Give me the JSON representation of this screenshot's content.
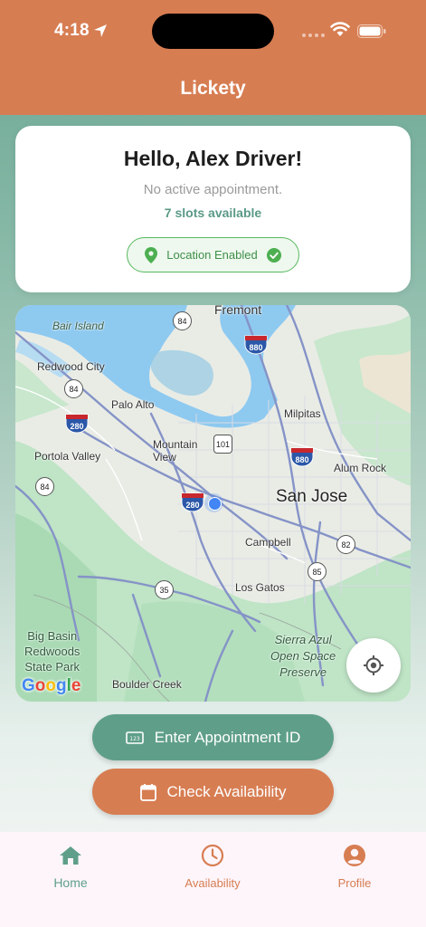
{
  "status_bar": {
    "time": "4:18"
  },
  "header": {
    "title": "Lickety"
  },
  "greeting": {
    "title": "Hello, Alex Driver!",
    "appointment_status": "No active appointment.",
    "slots_available": "7 slots available",
    "location_badge": "Location Enabled"
  },
  "map": {
    "labels": {
      "fremont": "Fremont",
      "bair_island": "Bair Island",
      "redwood_city": "Redwood City",
      "palo_alto": "Palo Alto",
      "milpitas": "Milpitas",
      "mountain_view": "Mountain\nView",
      "portola_valley": "Portola Valley",
      "alum_rock": "Alum Rock",
      "san_jose": "San Jose",
      "campbell": "Campbell",
      "los_gatos": "Los Gatos",
      "big_basin": "Big Basin\nRedwoods\nState Park",
      "sierra_azul": "Sierra Azul\nOpen Space\nPreserve",
      "boulder_creek": "Boulder Creek"
    },
    "shields": {
      "r84a": "84",
      "r84b": "84",
      "r84c": "84",
      "r880a": "880",
      "r880b": "880",
      "r280a": "280",
      "r280b": "280",
      "r101": "101",
      "r82": "82",
      "r85": "85",
      "r35": "35"
    },
    "attribution": "Google"
  },
  "actions": {
    "enter_appointment": "Enter Appointment ID",
    "check_availability": "Check Availability"
  },
  "nav": {
    "home": "Home",
    "availability": "Availability",
    "profile": "Profile"
  },
  "colors": {
    "primary_orange": "#d77d52",
    "primary_green": "#5f9f89",
    "success_green": "#58b85e"
  }
}
